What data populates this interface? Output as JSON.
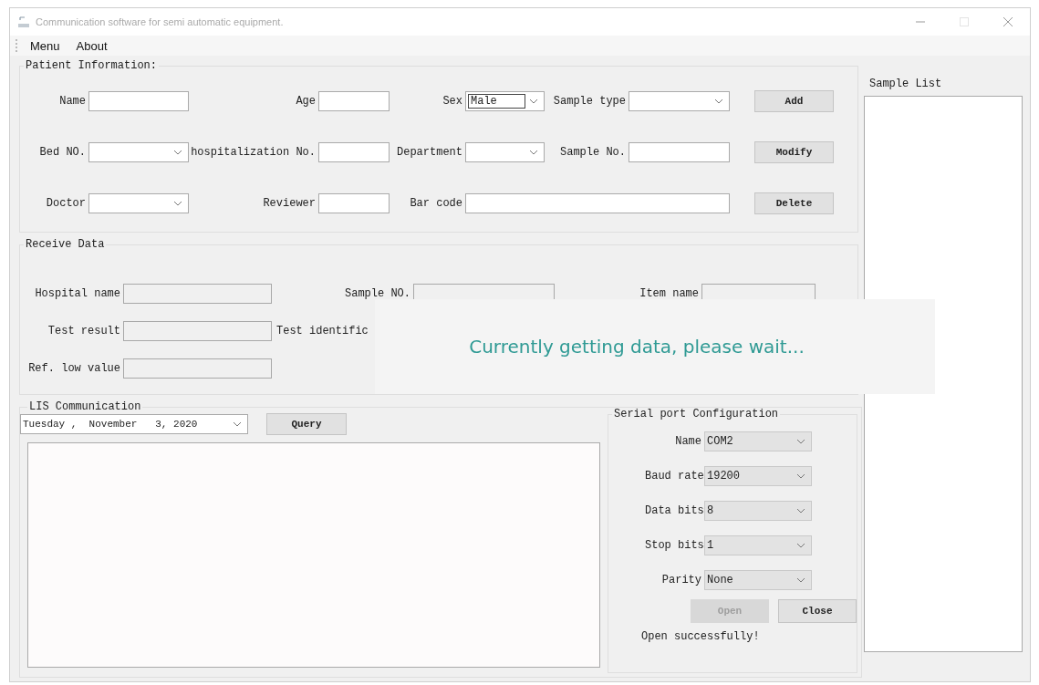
{
  "window": {
    "title": "Communication software for semi automatic equipment."
  },
  "menu": [
    {
      "label": "Menu"
    },
    {
      "label": "About"
    }
  ],
  "patient_information": {
    "title": "Patient Information:",
    "rows": [
      {
        "fields": [
          {
            "label": "Name",
            "kind": "text"
          },
          {
            "label": "Age",
            "kind": "text"
          },
          {
            "label": "Sex",
            "kind": "select",
            "value": "Male"
          },
          {
            "label": "Sample type",
            "kind": "select"
          }
        ],
        "button": "Add"
      },
      {
        "fields": [
          {
            "label": "Bed NO.",
            "kind": "select"
          },
          {
            "label": "hospitalization No.",
            "kind": "text"
          },
          {
            "label": "Department",
            "kind": "select"
          },
          {
            "label": "Sample No.",
            "kind": "text"
          }
        ],
        "button": "Modify"
      },
      {
        "fields": [
          {
            "label": "Doctor",
            "kind": "select"
          },
          {
            "label": "Reviewer",
            "kind": "text"
          },
          {
            "label": "Bar code",
            "kind": "text"
          }
        ],
        "button": "Delete"
      }
    ]
  },
  "receive_data": {
    "title": "Receive Data",
    "rows": [
      {
        "fields": [
          {
            "label": "Hospital name",
            "kind": "text"
          },
          {
            "label": "Sample NO.",
            "kind": "text"
          },
          {
            "label": "Item name",
            "kind": "text"
          }
        ]
      },
      {
        "fields": [
          {
            "label": "Test result",
            "kind": "text"
          },
          {
            "label": "Test identific",
            "kind": "label"
          }
        ]
      },
      {
        "fields": [
          {
            "label": "Ref. low value",
            "kind": "text"
          }
        ]
      }
    ]
  },
  "loading_toast": {
    "message": "Currently getting data, please wait..."
  },
  "lis_communication": {
    "title": "LIS Communication",
    "date": "Tuesday ,  November   3, 2020",
    "query_button": "Query"
  },
  "serial_port": {
    "title": "Serial port Configuration",
    "fields": [
      {
        "label": "Name",
        "value": "COM2"
      },
      {
        "label": "Baud rate",
        "value": "19200"
      },
      {
        "label": "Data bits",
        "value": "8"
      },
      {
        "label": "Stop bits",
        "value": "1"
      },
      {
        "label": "Parity",
        "value": "None"
      }
    ],
    "buttons": [
      {
        "label": "Open",
        "disabled": true
      },
      {
        "label": "Close",
        "disabled": false
      }
    ],
    "status": "Open successfully!"
  },
  "sample_list": {
    "title": "Sample List"
  }
}
